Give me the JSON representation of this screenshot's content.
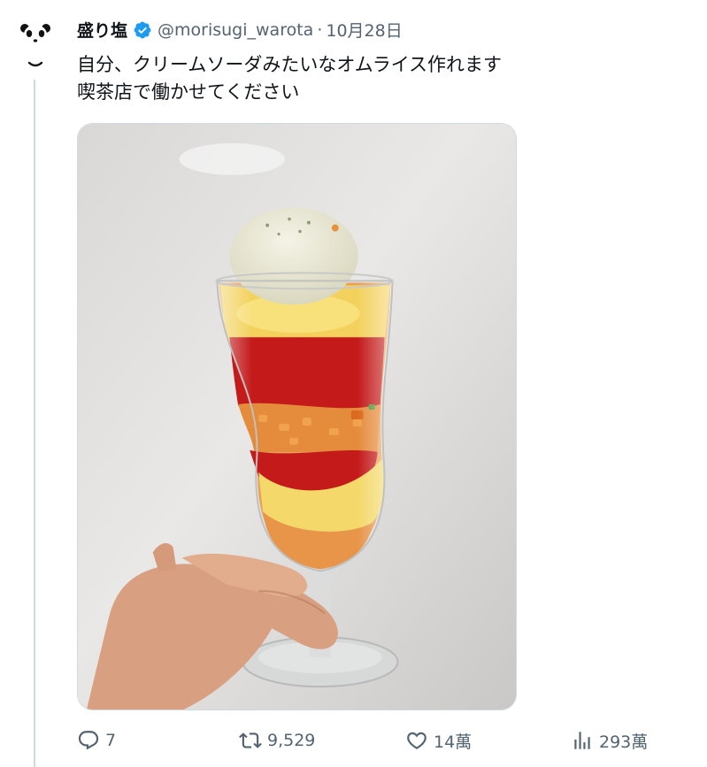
{
  "tweet": {
    "display_name": "盛り塩",
    "handle": "@morisugi_warota",
    "separator": "·",
    "date": "10月28日",
    "text_lines": [
      "自分、クリームソーダみたいなオムライス作れます",
      "喫茶店で働かせてください"
    ]
  },
  "actions": {
    "reply_count": "7",
    "retweet_count": "9,529",
    "like_count": "14萬",
    "view_count": "293萬"
  },
  "icons": {
    "avatar": "panda-avatar-icon",
    "verified": "verified-badge-icon",
    "reply": "reply-icon",
    "retweet": "retweet-icon",
    "like": "heart-icon",
    "views": "views-chart-icon"
  },
  "colors": {
    "verified": "#1d9bf0",
    "secondary_text": "#536471",
    "thread_line": "#cfd9de"
  }
}
